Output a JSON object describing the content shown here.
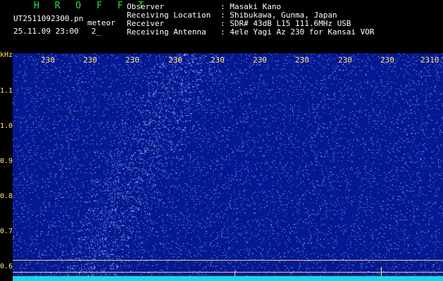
{
  "header": {
    "brand": "H R O F F T",
    "filename": "UT2511092300.pn",
    "tag": "meteor",
    "datetime": "25.11.09 23:00",
    "extra": "2_",
    "fields": [
      {
        "label": "Observer",
        "value": ": Masaki Kano"
      },
      {
        "label": "Receiving Location",
        "value": ": Shibukawa, Gunma, Japan"
      },
      {
        "label": "Receiver",
        "value": ": SDR# 43dB L15 111.6MHz USB"
      },
      {
        "label": "Receiving Antenna",
        "value": ": 4ele Yagi Az 230 for Kansai VOR"
      }
    ]
  },
  "axis": {
    "unit": "kHz",
    "y_labels": [
      "1.1",
      "1.0",
      "0.9",
      "0.8",
      "0.7",
      "0.6"
    ],
    "x_labels": [
      "230",
      "230",
      "230",
      "230",
      "230",
      "230",
      "230",
      "230",
      "230",
      "2310"
    ]
  },
  "colors": {
    "accent": "#ffe873",
    "brand": "#22e33a",
    "baseline": "#18d6e8",
    "noise": "#1a2fc8"
  }
}
